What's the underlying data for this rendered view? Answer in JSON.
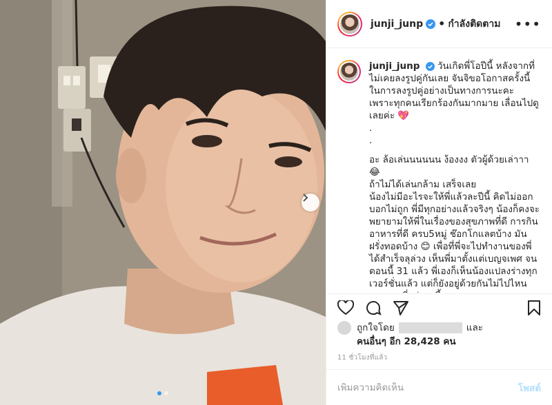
{
  "post": {
    "username": "junji_junp",
    "follow_status": "กำลังติดตาม",
    "caption_lines": [
      "วันเกิดพี่โอปีนี้ หลังจากที่ไม่เคยลงรูปคู่กันเลย จันจิขอโอกาสครั้งนี้ในการลงรูปคู่อย่างเป็นทางการนะคะ เพราะทุกคนเรียกร้องกันมากมาย เลื่อนไปดูเลยค่ะ 💖",
      ".",
      ".",
      "อะ ล้อเล่นนนนนน ง้องงง ตัวผู้ด้วยเล่าาา 😂",
      "ถ้าไม่ได้เล่นกล้าม เสร็จเลย",
      "น้องไม่มีอะไรจะให้พี่แล้วละปีนี้ คิดไม่ออกบอกไม่ถูก พี่มีทุกอย่างแล้วจริงๆ น้องก็คงจะพยายามให้พี่ในเรื่องของสุขภาพที่ดี การกินอาหารที่ดี ครบ5หมู่ ช๊อกโกแลตบ้าง มันฝรั่งทอดบ้าง 😊 เพื่อที่พี่จะไปทำงานของพี่ได้สำเร็จลุล่วง เห็นพี่มาตั้งแต่เบญจเพศ จนตอนนี้ 31 แล้ว พี่เองก็เห็นน้องแปลงร่างทุกเวอร์ชั่นแล้ว แต่ก็ยังอยู่ด้วยกันไม่ไปไหน ขอบคุณที่อยู่ตรงนี้นะคะ"
    ],
    "likes": {
      "prefix": "ถูกใจโดย",
      "and": "และ",
      "others": "คนอื่นๆ อีก 28,428 คน"
    },
    "timestamp": "11 ชั่วโมงที่แล้ว",
    "comment_placeholder": "เพิ่มความคิดเห็น",
    "post_button": "โพสต์"
  },
  "carousel": {
    "total": 2,
    "active": 0
  },
  "colors": {
    "verified": "#3897f0",
    "active_dot": "#3897f0",
    "post_button": "#b2dffc",
    "heart_red": "#ed4956"
  },
  "icons": [
    "verified-badge-icon",
    "more-options-icon",
    "heart-icon",
    "comment-icon",
    "share-icon",
    "bookmark-icon",
    "chevron-right-icon"
  ]
}
